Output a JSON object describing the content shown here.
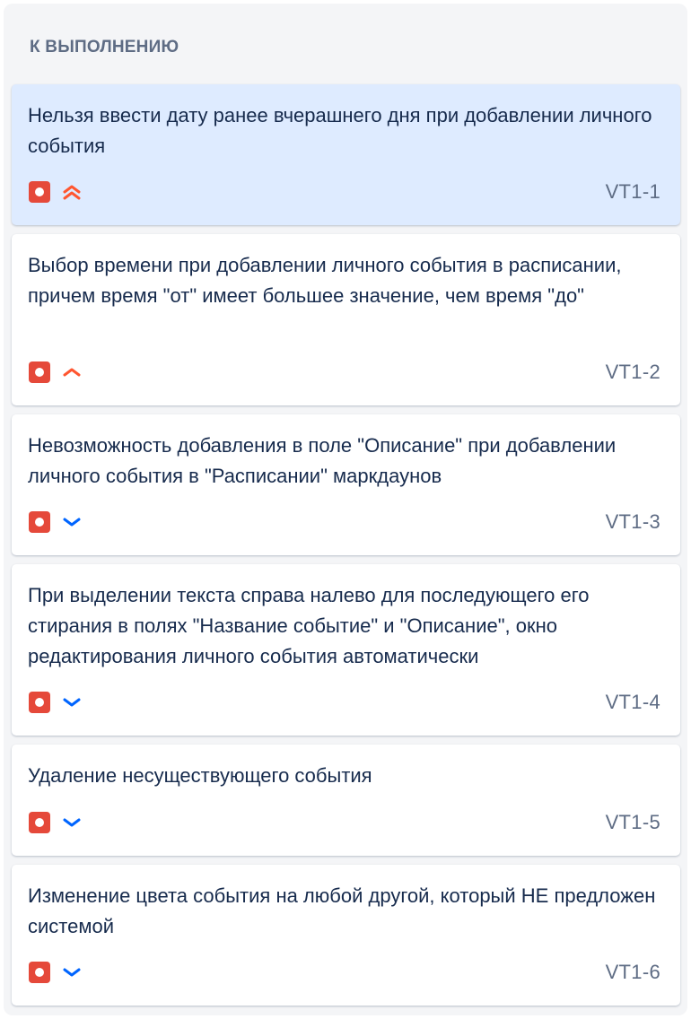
{
  "column": {
    "title": "К ВЫПОЛНЕНИЮ"
  },
  "colors": {
    "column_bg": "#f4f5f7",
    "card_bg": "#ffffff",
    "selected_card_bg": "#deebff",
    "bug_icon": "#e5493a",
    "priority_high": "#ff5630",
    "priority_low": "#0065ff",
    "text": "#172b4d",
    "muted_text": "#5e6c84"
  },
  "cards": [
    {
      "summary": "Нельзя ввести дату ранее вчерашнего дня при добавлении личного события",
      "key": "VT1-1",
      "type_icon": "bug-icon",
      "priority": "highest",
      "priority_icon": "priority-highest-icon",
      "selected": true
    },
    {
      "summary": "Выбор времени при добавлении личного события в расписании, причем время \"от\" имеет большее значение, чем время \"до\"",
      "key": "VT1-2",
      "type_icon": "bug-icon",
      "priority": "high",
      "priority_icon": "priority-high-icon",
      "selected": false
    },
    {
      "summary": "Невозможность добавления в поле \"Описание\" при добавлении личного события в \"Расписании\" маркдаунов",
      "key": "VT1-3",
      "type_icon": "bug-icon",
      "priority": "low",
      "priority_icon": "priority-low-icon",
      "selected": false
    },
    {
      "summary": "При выделении текста справа налево для последующего его стирания в полях \"Название событие\" и \"Описание\", окно редактирования личного события автоматически",
      "key": "VT1-4",
      "type_icon": "bug-icon",
      "priority": "low",
      "priority_icon": "priority-low-icon",
      "selected": false
    },
    {
      "summary": "Удаление несуществующего события",
      "key": "VT1-5",
      "type_icon": "bug-icon",
      "priority": "low",
      "priority_icon": "priority-low-icon",
      "selected": false
    },
    {
      "summary": "Изменение цвета события на любой другой, который НЕ предложен системой",
      "key": "VT1-6",
      "type_icon": "bug-icon",
      "priority": "low",
      "priority_icon": "priority-low-icon",
      "selected": false
    }
  ]
}
